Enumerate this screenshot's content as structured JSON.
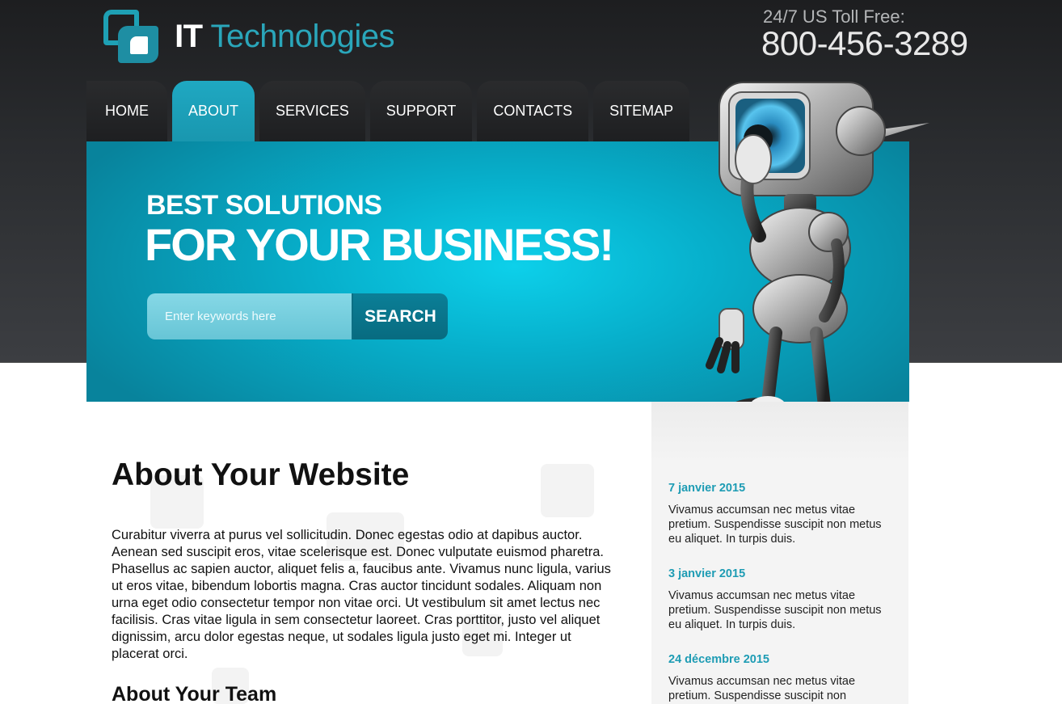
{
  "brand": {
    "logo_bold": "IT",
    "logo_light": "Technologies",
    "toll_label": "24/7 US Toll Free:",
    "toll_phone": "800-456-3289"
  },
  "nav": {
    "items": [
      {
        "label": "HOME",
        "active": false
      },
      {
        "label": "ABOUT",
        "active": true
      },
      {
        "label": "SERVICES",
        "active": false
      },
      {
        "label": "SUPPORT",
        "active": false
      },
      {
        "label": "CONTACTS",
        "active": false
      },
      {
        "label": "SITEMAP",
        "active": false
      }
    ]
  },
  "hero": {
    "line1": "BEST SOLUTIONS",
    "line2": "FOR YOUR BUSINESS!",
    "search_placeholder": "Enter keywords here",
    "search_value": "",
    "search_button": "SEARCH"
  },
  "main": {
    "title": "About Your Website",
    "body": "Curabitur viverra at purus vel sollicitudin. Donec egestas odio at dapibus auctor. Aenean sed suscipit eros, vitae scelerisque est. Donec vulputate euismod pharetra. Phasellus ac sapien auctor, aliquet felis a, faucibus ante. Vivamus nunc ligula, varius ut eros vitae, bibendum lobortis magna. Cras auctor tincidunt sodales. Aliquam non urna eget odio consectetur tempor non vitae orci. Ut vestibulum sit amet lectus nec facilisis. Cras vitae ligula in sem consectetur laoreet. Cras porttitor, justo vel aliquet dignissim, arcu dolor egestas neque, ut sodales ligula justo eget mi. Integer ut placerat orci.",
    "team_title": "About Your Team"
  },
  "news": {
    "items": [
      {
        "date": "7 janvier 2015",
        "text": "Vivamus accumsan nec metus vitae pretium. Suspendisse suscipit non metus eu aliquet. In turpis duis."
      },
      {
        "date": "3 janvier 2015",
        "text": "Vivamus accumsan nec metus vitae pretium. Suspendisse suscipit non metus eu aliquet. In turpis duis."
      },
      {
        "date": "24 décembre 2015",
        "text": "Vivamus accumsan nec metus vitae pretium. Suspendisse suscipit non"
      }
    ]
  },
  "colors": {
    "accent": "#1ea0b4",
    "hero": "#07b0cc",
    "header_dark": "#2a2c2f",
    "sidebar": "#f4f4f4"
  },
  "icons": {
    "logo": "logo-icon",
    "hero_image": "robot-illustration"
  }
}
